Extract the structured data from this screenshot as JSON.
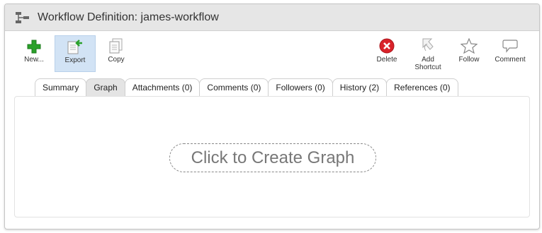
{
  "window": {
    "title": "Workflow Definition: james-workflow",
    "icon": "workflow-icon"
  },
  "toolbar": {
    "new_label": "New...",
    "export_label": "Export",
    "copy_label": "Copy",
    "delete_label": "Delete",
    "add_shortcut_line1": "Add",
    "add_shortcut_line2": "Shortcut",
    "follow_label": "Follow",
    "comment_label": "Comment",
    "active_button": "Export"
  },
  "tabs": [
    {
      "label": "Summary",
      "active": false
    },
    {
      "label": "Graph",
      "active": true
    },
    {
      "label": "Attachments (0)",
      "active": false
    },
    {
      "label": "Comments (0)",
      "active": false
    },
    {
      "label": "Followers (0)",
      "active": false
    },
    {
      "label": "History (2)",
      "active": false
    },
    {
      "label": "References (0)",
      "active": false
    }
  ],
  "content": {
    "create_graph_label": "Click to Create Graph"
  },
  "colors": {
    "accent_green": "#2aa12a",
    "delete_red": "#d9222a",
    "active_button_bg": "#d2e3f5",
    "active_tab_bg": "#e4e4e4"
  }
}
